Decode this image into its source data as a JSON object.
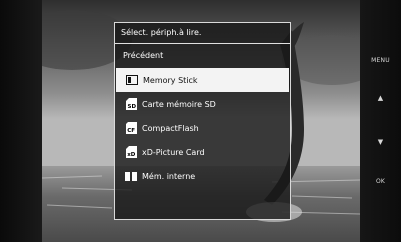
{
  "side_buttons": {
    "menu": "MENU",
    "up": "▲",
    "down": "▼",
    "ok": "OK"
  },
  "dialog": {
    "title": "Sélect. périph.à lire.",
    "previous_label": "Précédent",
    "items": [
      {
        "label": "Memory Stick",
        "icon": "memory-stick-icon",
        "selected": true
      },
      {
        "label": "Carte mémoire SD",
        "icon": "sd-card-icon",
        "selected": false
      },
      {
        "label": "CompactFlash",
        "icon": "compactflash-icon",
        "selected": false
      },
      {
        "label": "xD-Picture Card",
        "icon": "xd-card-icon",
        "selected": false
      },
      {
        "label": "Mém. interne",
        "icon": "internal-memory-icon",
        "selected": false
      }
    ]
  },
  "colors": {
    "dialog_border": "#d9d9d9",
    "selection_background": "#f3f3f3"
  }
}
